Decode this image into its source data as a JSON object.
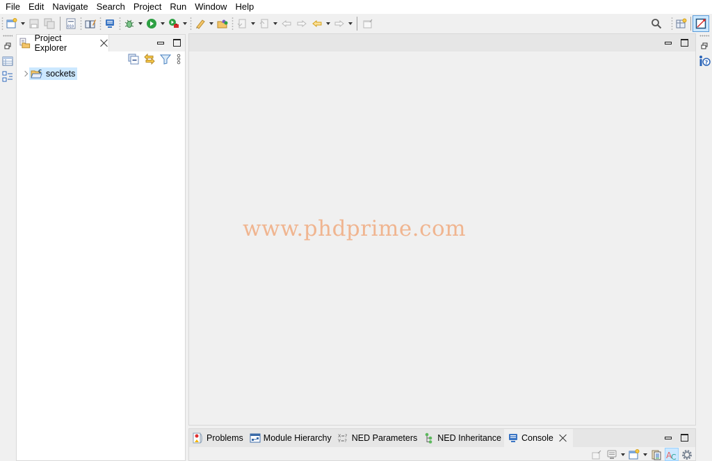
{
  "menubar": {
    "items": [
      "File",
      "Edit",
      "Navigate",
      "Search",
      "Project",
      "Run",
      "Window",
      "Help"
    ]
  },
  "toolbar": {
    "buttons": [
      {
        "name": "new-icon",
        "dropdown": true
      },
      {
        "name": "save-icon"
      },
      {
        "name": "save-all-icon"
      },
      {
        "name": "binary-file-icon"
      },
      {
        "name": "open-editor-icon"
      },
      {
        "name": "display-icon"
      },
      {
        "name": "debug-icon",
        "dropdown": true
      },
      {
        "name": "run-icon",
        "dropdown": true
      },
      {
        "name": "external-tools-icon",
        "dropdown": true
      },
      {
        "name": "pencil-icon",
        "dropdown": true
      },
      {
        "name": "open-folder-icon"
      },
      {
        "name": "next-annotation-icon",
        "dropdown": true
      },
      {
        "name": "previous-annotation-icon",
        "dropdown": true
      },
      {
        "name": "last-edit-icon"
      },
      {
        "name": "forward-edit-icon"
      },
      {
        "name": "back-icon",
        "dropdown": true
      },
      {
        "name": "forward-icon",
        "dropdown": true
      },
      {
        "name": "pin-editor-icon"
      }
    ],
    "right": [
      "search-icon",
      "open-perspective-icon",
      "omnet-perspective-icon"
    ]
  },
  "project_explorer": {
    "tab_label": "Project Explorer",
    "tree": [
      {
        "label": "sockets",
        "expanded": false,
        "selected": true
      }
    ]
  },
  "editor": {
    "watermark": "www.phdprime.com"
  },
  "bottom_panel": {
    "tabs": [
      {
        "label": "Problems",
        "icon": "problems-icon",
        "active": false
      },
      {
        "label": "Module Hierarchy",
        "icon": "module-hierarchy-icon",
        "active": false
      },
      {
        "label": "NED Parameters",
        "icon": "ned-parameters-icon",
        "active": false
      },
      {
        "label": "NED Inheritance",
        "icon": "ned-inheritance-icon",
        "active": false
      },
      {
        "label": "Console",
        "icon": "console-icon",
        "active": true
      }
    ]
  },
  "colors": {
    "selection": "#cce8ff",
    "watermark": "#f0b590",
    "panel_bg": "#f0f0f0",
    "header_bg": "#e6e6e6"
  }
}
